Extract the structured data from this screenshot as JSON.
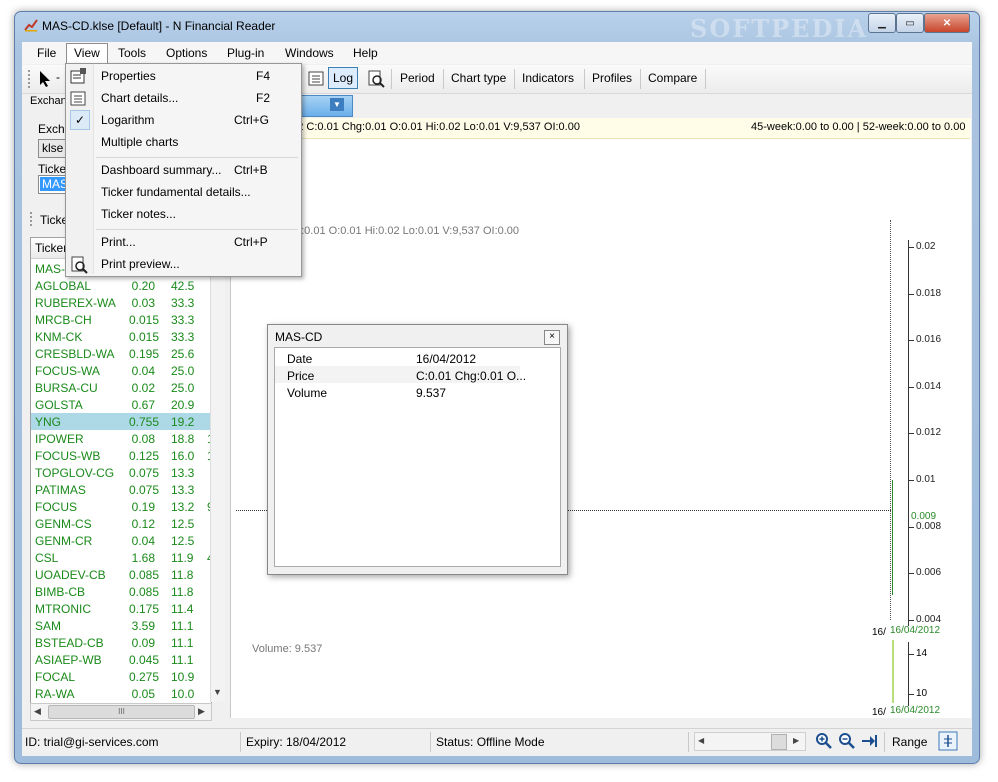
{
  "window": {
    "title": "MAS-CD.klse [Default] - N Financial Reader",
    "watermark": "SOFTPEDIA"
  },
  "menu": [
    "File",
    "View",
    "Tools",
    "Options",
    "Plug-in",
    "Windows",
    "Help"
  ],
  "toolbar": {
    "log_label": "Log",
    "buttons": [
      "Period",
      "Chart type",
      "Indicators",
      "Profiles",
      "Compare"
    ]
  },
  "left_panel": {
    "exchange_tab": "Exchan",
    "exchange_label": "Excha",
    "exchange_value": "klse",
    "ticker_label": "Ticke",
    "ticker_value": "MAS",
    "ticker_group_label": "Ticke",
    "list_header": "Ticker",
    "rows": [
      {
        "t": "MAS-C",
        "a": "",
        "b": "",
        "c": ""
      },
      {
        "t": "AGLOBAL",
        "a": "0.20",
        "b": "42.5",
        "c": ""
      },
      {
        "t": "RUBEREX-WA",
        "a": "0.03",
        "b": "33.3",
        "c": ""
      },
      {
        "t": "MRCB-CH",
        "a": "0.015",
        "b": "33.3",
        "c": ""
      },
      {
        "t": "KNM-CK",
        "a": "0.015",
        "b": "33.3",
        "c": ""
      },
      {
        "t": "CRESBLD-WA",
        "a": "0.195",
        "b": "25.6",
        "c": ""
      },
      {
        "t": "FOCUS-WA",
        "a": "0.04",
        "b": "25.0",
        "c": ""
      },
      {
        "t": "BURSA-CU",
        "a": "0.02",
        "b": "25.0",
        "c": ""
      },
      {
        "t": "GOLSTA",
        "a": "0.67",
        "b": "20.9",
        "c": ""
      },
      {
        "t": "YNG",
        "a": "0.755",
        "b": "19.2",
        "c": ""
      },
      {
        "t": "IPOWER",
        "a": "0.08",
        "b": "18.8",
        "c": "1"
      },
      {
        "t": "FOCUS-WB",
        "a": "0.125",
        "b": "16.0",
        "c": "1"
      },
      {
        "t": "TOPGLOV-CG",
        "a": "0.075",
        "b": "13.3",
        "c": ""
      },
      {
        "t": "PATIMAS",
        "a": "0.075",
        "b": "13.3",
        "c": ""
      },
      {
        "t": "FOCUS",
        "a": "0.19",
        "b": "13.2",
        "c": "9"
      },
      {
        "t": "GENM-CS",
        "a": "0.12",
        "b": "12.5",
        "c": ""
      },
      {
        "t": "GENM-CR",
        "a": "0.04",
        "b": "12.5",
        "c": ""
      },
      {
        "t": "CSL",
        "a": "1.68",
        "b": "11.9",
        "c": "4"
      },
      {
        "t": "UOADEV-CB",
        "a": "0.085",
        "b": "11.8",
        "c": ""
      },
      {
        "t": "BIMB-CB",
        "a": "0.085",
        "b": "11.8",
        "c": ""
      },
      {
        "t": "MTRONIC",
        "a": "0.175",
        "b": "11.4",
        "c": ""
      },
      {
        "t": "SAM",
        "a": "3.59",
        "b": "11.1",
        "c": ""
      },
      {
        "t": "BSTEAD-CB",
        "a": "0.09",
        "b": "11.1",
        "c": ""
      },
      {
        "t": "ASIAEP-WB",
        "a": "0.045",
        "b": "11.1",
        "c": ""
      },
      {
        "t": "FOCAL",
        "a": "0.275",
        "b": "10.9",
        "c": ""
      },
      {
        "t": "RA-WA",
        "a": "0.05",
        "b": "10.0",
        "c": ""
      }
    ],
    "selected_index": 9
  },
  "chart": {
    "tab_label": "e",
    "info_left": "012 C:0.01 Chg:0.01 O:0.01 Hi:0.02 Lo:0.01 V:9,537 OI:0.00",
    "info_right": "45-week:0.00 to 0.00 | 52-week:0.00 to 0.00",
    "overlay_text": "g:0.01 O:0.01 Hi:0.02 Lo:0.01 V:9,537 OI:0.00",
    "volume_label": "Volume: 9.537",
    "price_axis": [
      "0.02",
      "0.018",
      "0.016",
      "0.014",
      "0.012",
      "0.01",
      "0.008",
      "0.006",
      "0.004"
    ],
    "current_price": "0.009",
    "volume_axis": [
      "14",
      "10"
    ],
    "date_label": "16/04/2012",
    "date_prefix": "16/"
  },
  "view_menu": [
    {
      "label": "Properties",
      "shortcut": "F4",
      "icon": "properties-icon"
    },
    {
      "label": "Chart details...",
      "shortcut": "F2",
      "icon": "chart-details-icon"
    },
    {
      "label": "Logarithm",
      "shortcut": "Ctrl+G",
      "checked": true
    },
    {
      "label": "Multiple charts",
      "shortcut": ""
    },
    {
      "label": "Dashboard summary...",
      "shortcut": "Ctrl+B"
    },
    {
      "label": "Ticker fundamental details...",
      "shortcut": ""
    },
    {
      "label": "Ticker notes...",
      "shortcut": ""
    },
    {
      "label": "Print...",
      "shortcut": "Ctrl+P"
    },
    {
      "label": "Print preview...",
      "shortcut": "",
      "icon": "print-preview-icon"
    }
  ],
  "popup": {
    "title": "MAS-CD",
    "close": "×",
    "fields": [
      {
        "k": "Date",
        "v": "16/04/2012"
      },
      {
        "k": "Price",
        "v": "C:0.01 Chg:0.01 O..."
      },
      {
        "k": "Volume",
        "v": "9.537"
      }
    ]
  },
  "status": {
    "id": "ID: trial@gi-services.com",
    "expiry": "Expiry: 18/04/2012",
    "mode": "Status: Offline Mode",
    "range_label": "Range"
  }
}
